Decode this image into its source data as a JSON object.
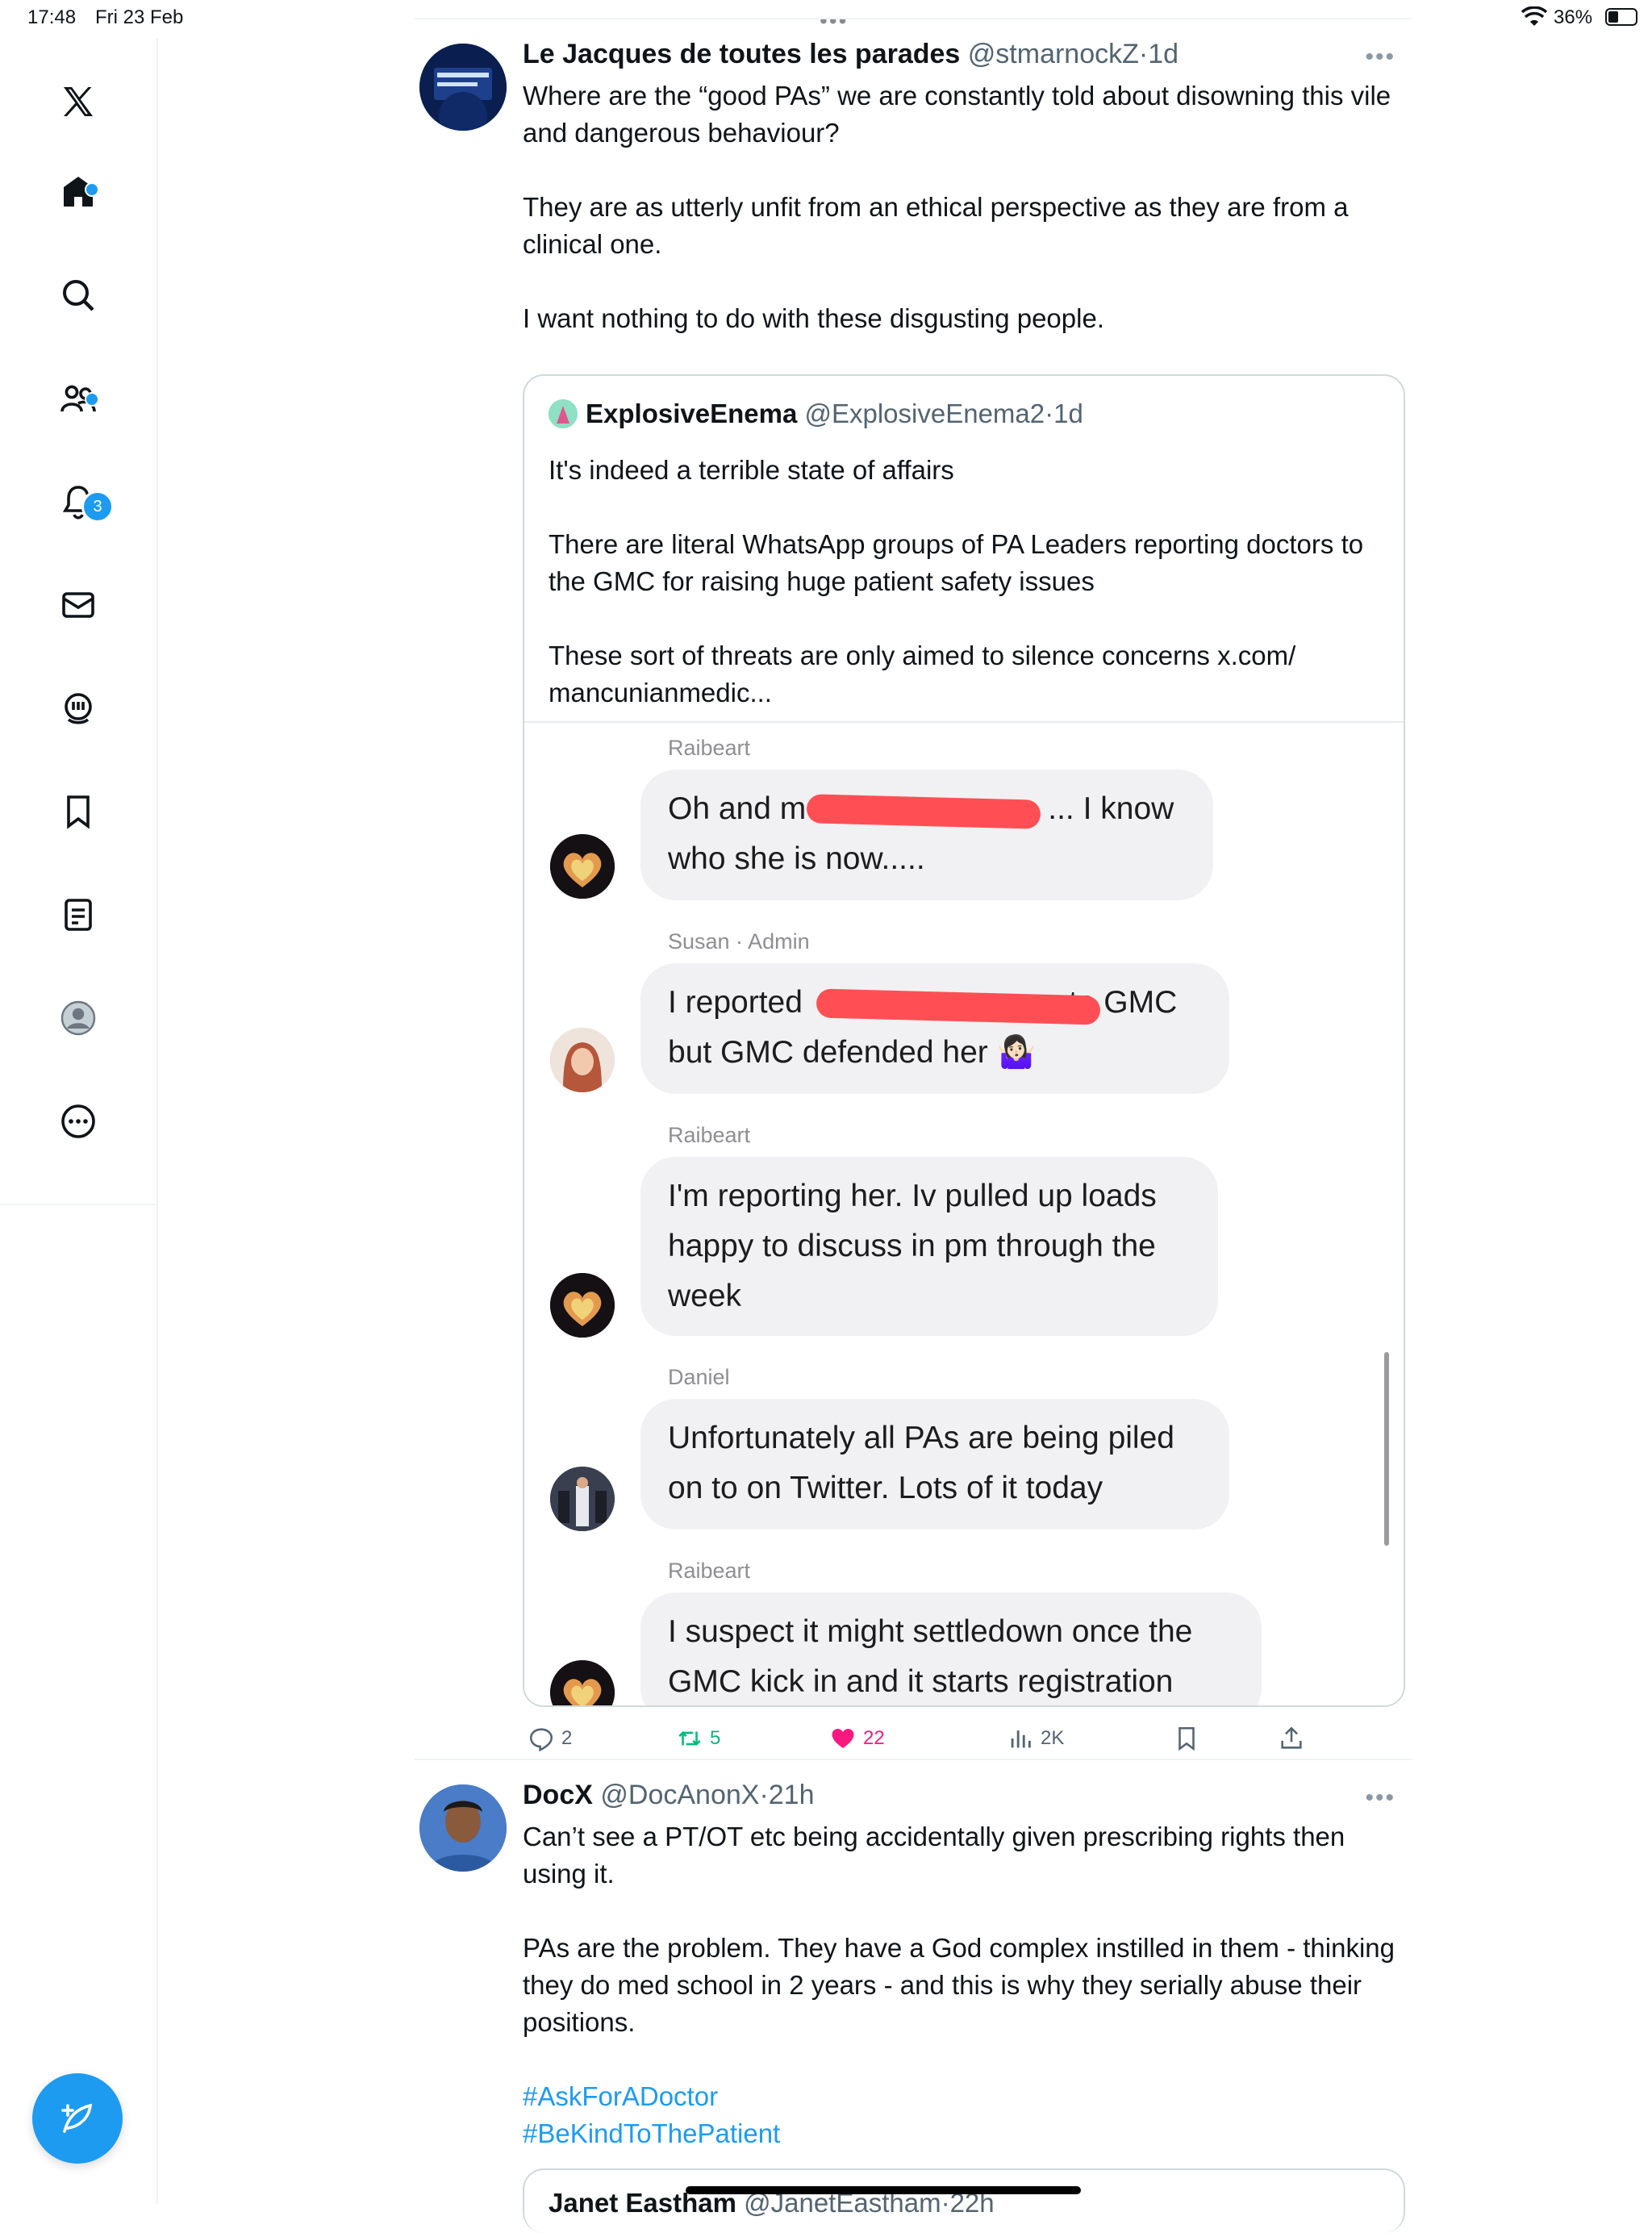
{
  "status_bar": {
    "time": "17:48",
    "date": "Fri 23 Feb",
    "battery": "36%"
  },
  "sidebar": {
    "items": [
      {
        "name": "x-logo-icon"
      },
      {
        "name": "home-icon",
        "has_dot": true
      },
      {
        "name": "search-icon"
      },
      {
        "name": "communities-icon",
        "has_dot": true
      },
      {
        "name": "notifications-icon",
        "badge": "3"
      },
      {
        "name": "messages-icon"
      },
      {
        "name": "grok-icon"
      },
      {
        "name": "bookmarks-icon"
      },
      {
        "name": "lists-icon"
      },
      {
        "name": "profile-icon"
      },
      {
        "name": "more-icon"
      }
    ],
    "accent": "#1d9bf0"
  },
  "tweet1": {
    "name": "Le Jacques de toutes les parades",
    "handle": "@stmarnockZ",
    "time": "1d",
    "paragraphs": [
      "Where are the “good PAs” we are constantly told about disowning this vile and dangerous behaviour?",
      "They are as utterly unfit from an ethical perspective as they are from a clinical one.",
      "I want nothing to do with these disgusting people."
    ],
    "quote": {
      "name": "ExplosiveEnema",
      "handle": "@ExplosiveEnema2",
      "time": "1d",
      "paragraphs": [
        "It's indeed a terrible state of affairs",
        "There are literal WhatsApp groups of PA Leaders reporting doctors to the GMC for raising huge patient safety issues",
        "These sort of threats are only aimed to silence concerns x.com/ mancunianmedic..."
      ],
      "chat": [
        {
          "sender": "Raibeart",
          "text_a": "Oh and m",
          "text_b": "... I know",
          "text_c": "who she is now....."
        },
        {
          "sender": "Susan · Admin",
          "text_a": "I reported",
          "text_b": "to GMC",
          "text_c": "but GMC defended her 🤷🏻‍♀️"
        },
        {
          "sender": "Raibeart",
          "text_a": "I'm reporting her. Iv pulled up loads",
          "text_b": "happy to discuss in pm through the",
          "text_c": "week"
        },
        {
          "sender": "Daniel",
          "text_a": "Unfortunately all PAs are being piled",
          "text_b": "on to on Twitter. Lots of it today"
        },
        {
          "sender": "Raibeart",
          "text_a": "I suspect it might settledown once the",
          "text_b": "GMC kick in and it starts registration"
        }
      ]
    },
    "actions": {
      "replies": "2",
      "reposts": "5",
      "likes": "22",
      "views": "2K"
    }
  },
  "tweet2": {
    "name": "DocX",
    "handle": "@DocAnonX",
    "time": "21h",
    "paragraphs": [
      "Can’t see a PT/OT etc being accidentally given prescribing rights then using it.",
      "PAs are the problem. They have a God complex instilled in them - thinking they do med school in 2 years - and this is why they serially abuse their positions."
    ],
    "hashtags": [
      "#AskForADoctor",
      "#BeKindToThePatient"
    ],
    "quote_name": "Janet Eastham",
    "quote_handle": "@JanetEastham",
    "quote_time": "22h"
  }
}
